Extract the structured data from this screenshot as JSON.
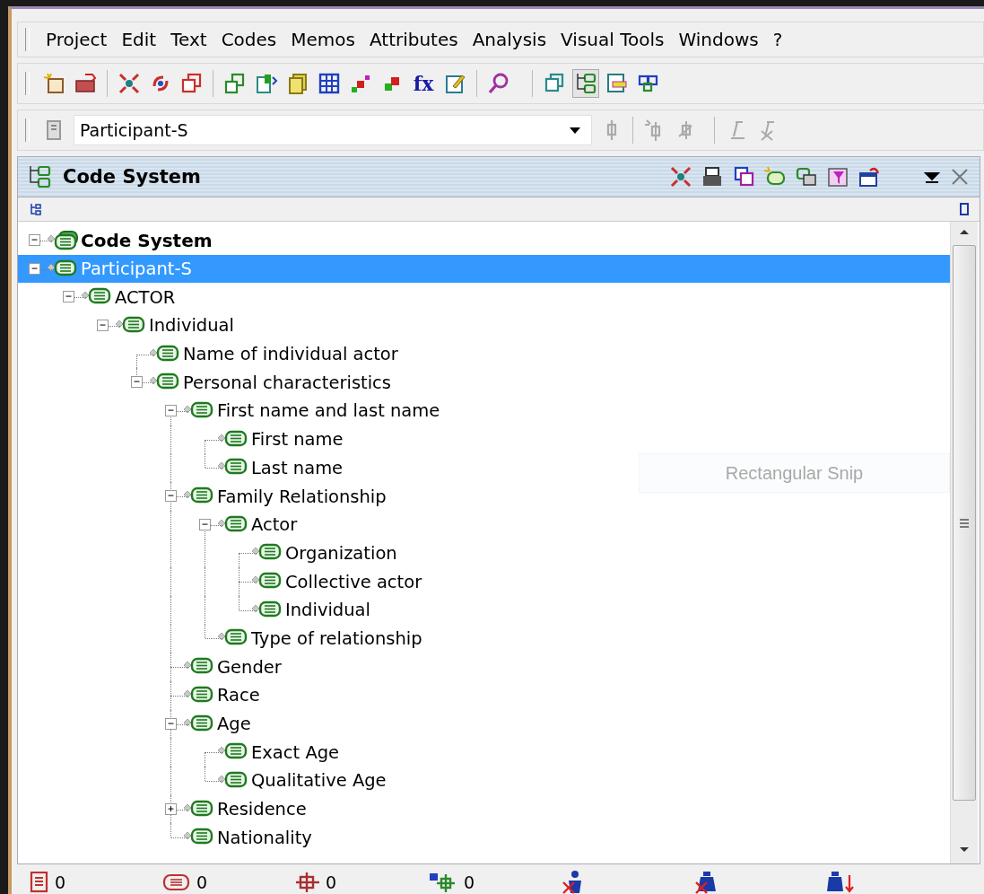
{
  "menu": [
    "Project",
    "Edit",
    "Text",
    "Codes",
    "Memos",
    "Attributes",
    "Analysis",
    "Visual Tools",
    "Windows",
    "?"
  ],
  "toolbar": {
    "function_label": "fx"
  },
  "code_combo": {
    "value": "Participant-S"
  },
  "panel": {
    "title": "Code System"
  },
  "tree": {
    "label": "Code System",
    "expanded": true,
    "selected": false,
    "children": [
      {
        "label": "Participant-S",
        "expanded": true,
        "selected": true,
        "children": [
          {
            "label": "ACTOR",
            "expanded": true,
            "selected": false,
            "children": [
              {
                "label": "Individual",
                "expanded": true,
                "selected": false,
                "children": [
                  {
                    "label": "Name of individual actor",
                    "selected": false
                  },
                  {
                    "label": "Personal characteristics",
                    "expanded": true,
                    "selected": false,
                    "children": [
                      {
                        "label": "First name and last name",
                        "expanded": true,
                        "selected": false,
                        "children": [
                          {
                            "label": "First name",
                            "selected": false
                          },
                          {
                            "label": "Last name",
                            "selected": false
                          }
                        ]
                      },
                      {
                        "label": "Family Relationship",
                        "expanded": true,
                        "selected": false,
                        "children": [
                          {
                            "label": "Actor",
                            "expanded": true,
                            "selected": false,
                            "children": [
                              {
                                "label": "Organization",
                                "selected": false
                              },
                              {
                                "label": "Collective actor",
                                "selected": false
                              },
                              {
                                "label": "Individual",
                                "selected": false
                              }
                            ]
                          },
                          {
                            "label": "Type of relationship",
                            "selected": false
                          }
                        ]
                      },
                      {
                        "label": "Gender",
                        "selected": false
                      },
                      {
                        "label": "Race",
                        "selected": false
                      },
                      {
                        "label": "Age",
                        "expanded": true,
                        "selected": false,
                        "children": [
                          {
                            "label": "Exact Age",
                            "selected": false
                          },
                          {
                            "label": "Qualitative Age",
                            "selected": false
                          }
                        ]
                      },
                      {
                        "label": "Residence",
                        "expanded": false,
                        "selected": false
                      },
                      {
                        "label": "Nationality",
                        "selected": false
                      }
                    ]
                  }
                ]
              }
            ]
          }
        ]
      }
    ]
  },
  "overlay_text": "Rectangular Snip",
  "status_bar": [
    {
      "kind": "documents",
      "count": "0"
    },
    {
      "kind": "codes",
      "count": "0"
    },
    {
      "kind": "memos",
      "count": "0"
    },
    {
      "kind": "links",
      "count": "0"
    },
    {
      "kind": "user"
    },
    {
      "kind": "weight"
    },
    {
      "kind": "sort"
    }
  ]
}
